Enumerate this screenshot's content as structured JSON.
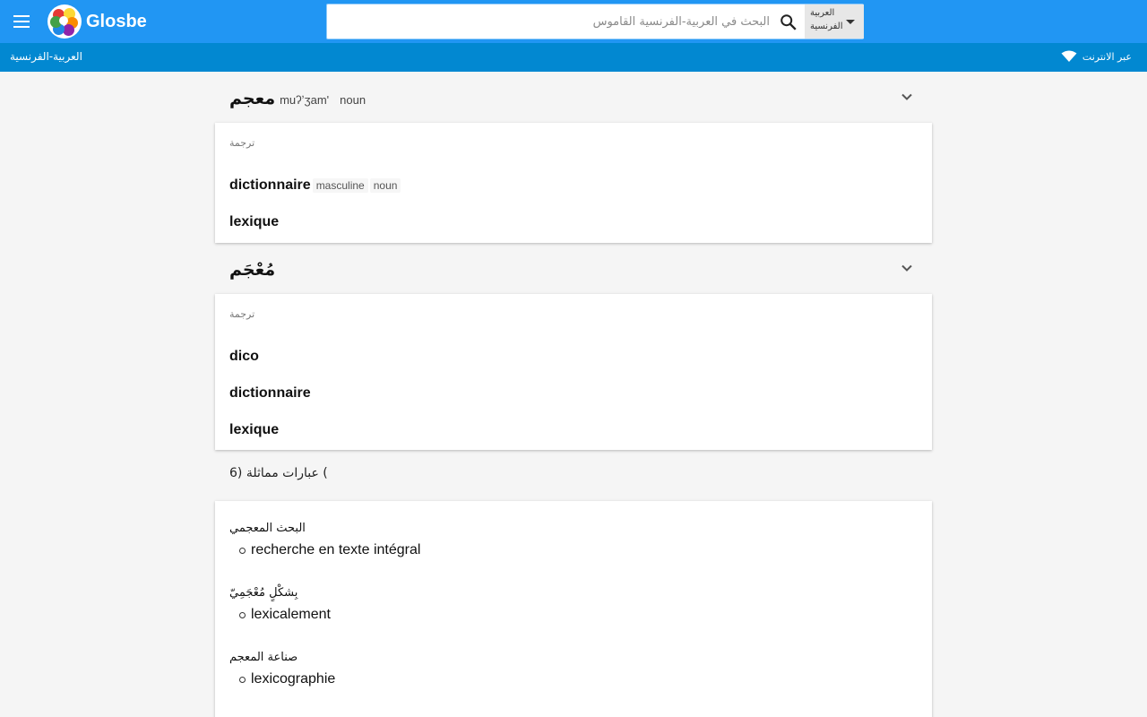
{
  "header": {
    "menu_icon": "hamburger-menu-icon",
    "logo_text": "Glosbe",
    "search_placeholder": "البحث في العربية-الفرنسية القاموس",
    "search_icon": "search-icon",
    "lang_from": "العربية",
    "lang_to": "الفرنسية"
  },
  "subbar": {
    "pair_label": "العربية-الفرنسية",
    "online_label": "عبر الانترنت",
    "online_icon": "wifi-icon"
  },
  "entries": [
    {
      "headword": "معجم",
      "transliteration": "muʔʼʒam'",
      "pos": "noun",
      "card_label": "ترجمة",
      "translations": [
        {
          "word": "dictionnaire",
          "tags": [
            "masculine",
            "noun"
          ]
        },
        {
          "word": "lexique",
          "tags": []
        }
      ]
    },
    {
      "headword": "مُعْجَم",
      "transliteration": "",
      "pos": "",
      "card_label": "ترجمة",
      "translations": [
        {
          "word": "dico",
          "tags": []
        },
        {
          "word": "dictionnaire",
          "tags": []
        },
        {
          "word": "lexique",
          "tags": []
        }
      ]
    }
  ],
  "similar": {
    "title": "6) عبارات مماثلة (",
    "phrases": [
      {
        "source": "البحث المعجمي",
        "translation": "recherche en texte intégral"
      },
      {
        "source": "بِشكْلٍ مُعْجَمِيّ",
        "translation": "lexicalement"
      },
      {
        "source": "صناعة المعجم",
        "translation": "lexicographie"
      }
    ]
  },
  "colors": {
    "topbar": "#2196f3",
    "subbar": "#0288d1",
    "background": "#f5f5f5"
  }
}
